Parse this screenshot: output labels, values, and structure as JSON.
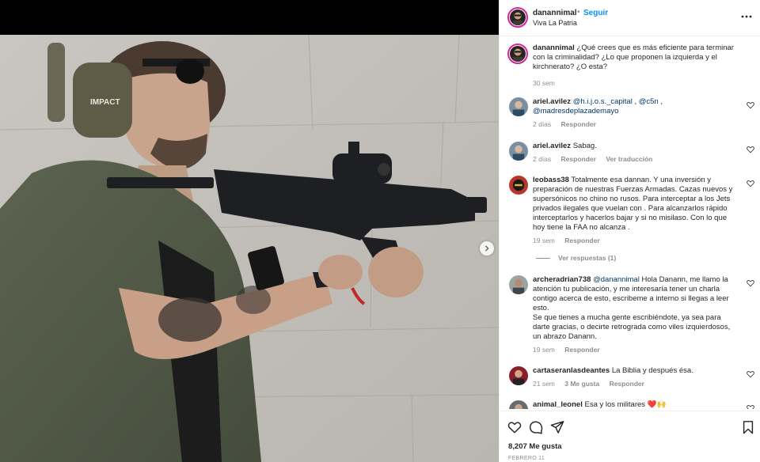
{
  "post": {
    "username": "danannimal",
    "follow_label": "Seguir",
    "location": "Viva La Patria",
    "more_icon": "more-horizontal-icon"
  },
  "caption": {
    "username": "danannimal",
    "text": "¿Qué crees que es más eficiente para terminar con la criminalidad? ¿Lo que proponen la izquierda y el kirchnerato? ¿O esta?",
    "time": "30 sem"
  },
  "comments": [
    {
      "username": "ariel.avilez",
      "mentions": [
        "@h.i.j.o.s._capital",
        "@c5n",
        "@madresdeplazademayo"
      ],
      "time": "2 días",
      "reply_label": "Responder"
    },
    {
      "username": "ariel.avilez",
      "text": "Sabag.",
      "time": "2 días",
      "reply_label": "Responder",
      "translate_label": "Ver traducción"
    },
    {
      "username": "leobass38",
      "text": "Totalmente esa dannan. Y una inversión y preparación de nuestras Fuerzas Armadas. Cazas nuevos y supersónicos no chino no rusos. Para interceptar a los Jets privados ilegales que vuelan con . Para alcanzarlos rápido interceptarlos y hacerlos bajar y si no misilaso. Con lo que hoy tiene la FAA no alcanza .",
      "time": "19 sem",
      "reply_label": "Responder",
      "view_replies": "Ver respuestas (1)"
    },
    {
      "username": "archeradrian738",
      "mention": "@danannimal",
      "text": "Hola Danann, me llamo la atención tu publicación, y me interesaría tener un charla contigo acerca de esto, escribeme a interno si llegas a leer esto.",
      "text2": "Se que tienes a mucha gente escribiéndote, ya sea para darte gracias, o decirte retrograda como viles izquierdosos, un abrazo Danann.",
      "time": "19 sem",
      "reply_label": "Responder"
    },
    {
      "username": "cartaseranlasdeantes",
      "text": "La Biblia y después ésa.",
      "time": "21 sem",
      "likes_label": "3 Me gusta",
      "reply_label": "Responder"
    },
    {
      "username": "animal_leonel",
      "text": "Esa y los militares ❤️🙌"
    }
  ],
  "actions": {
    "like_icon": "heart-icon",
    "comment_icon": "comment-icon",
    "share_icon": "send-icon",
    "save_icon": "bookmark-icon",
    "likes": "8,207 Me gusta",
    "date": "FEBRERO 11"
  },
  "media": {
    "photo_icon": "post-photo",
    "earmuff_brand": "IMPACT",
    "next_icon": "chevron-right-icon"
  }
}
